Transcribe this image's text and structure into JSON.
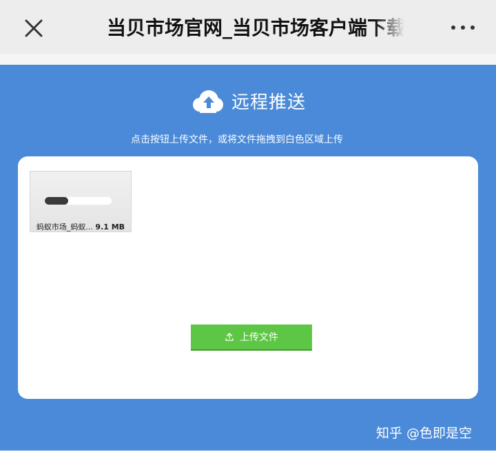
{
  "header": {
    "title": "当贝市场官网_当贝市场客户端下载",
    "close_icon": "close-icon",
    "more_icon": "more-dots-icon"
  },
  "panel": {
    "heading": "远程推送",
    "heading_icon": "cloud-upload-icon",
    "subtitle": "点击按钮上传文件，或将文件拖拽到白色区域上传",
    "background_color": "#4a8ad8"
  },
  "file": {
    "name": "蚂蚁市场_蚂蚁...",
    "size": "9.1 MB",
    "progress_percent": 35
  },
  "upload_button": {
    "label": "上传文件",
    "icon": "upload-icon",
    "color": "#5ec645"
  },
  "watermark": "知乎 @色即是空"
}
